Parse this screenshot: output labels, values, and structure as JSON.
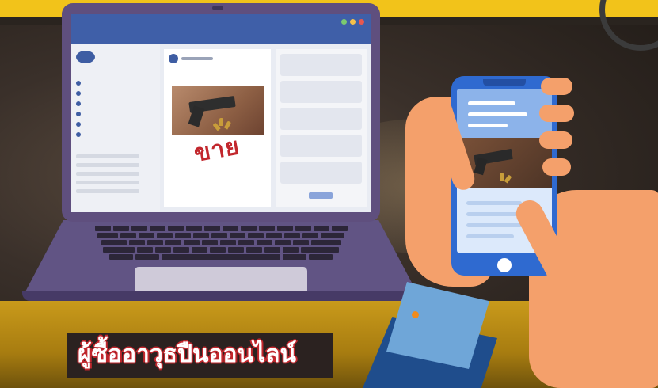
{
  "caption": {
    "text": "ผู้ซื้ออาวุธปืนออนไลน์"
  },
  "post_overlay": {
    "text": "ขาย"
  },
  "colors": {
    "accent_yellow": "#f2c31a",
    "laptop_purple": "#5f4f7e",
    "phone_blue": "#2f6ad0",
    "sale_red": "#c2272d",
    "skin": "#f4a06b"
  },
  "icons": [
    "laptop-icon",
    "smartphone-icon",
    "handgun-image",
    "hand-icon"
  ]
}
